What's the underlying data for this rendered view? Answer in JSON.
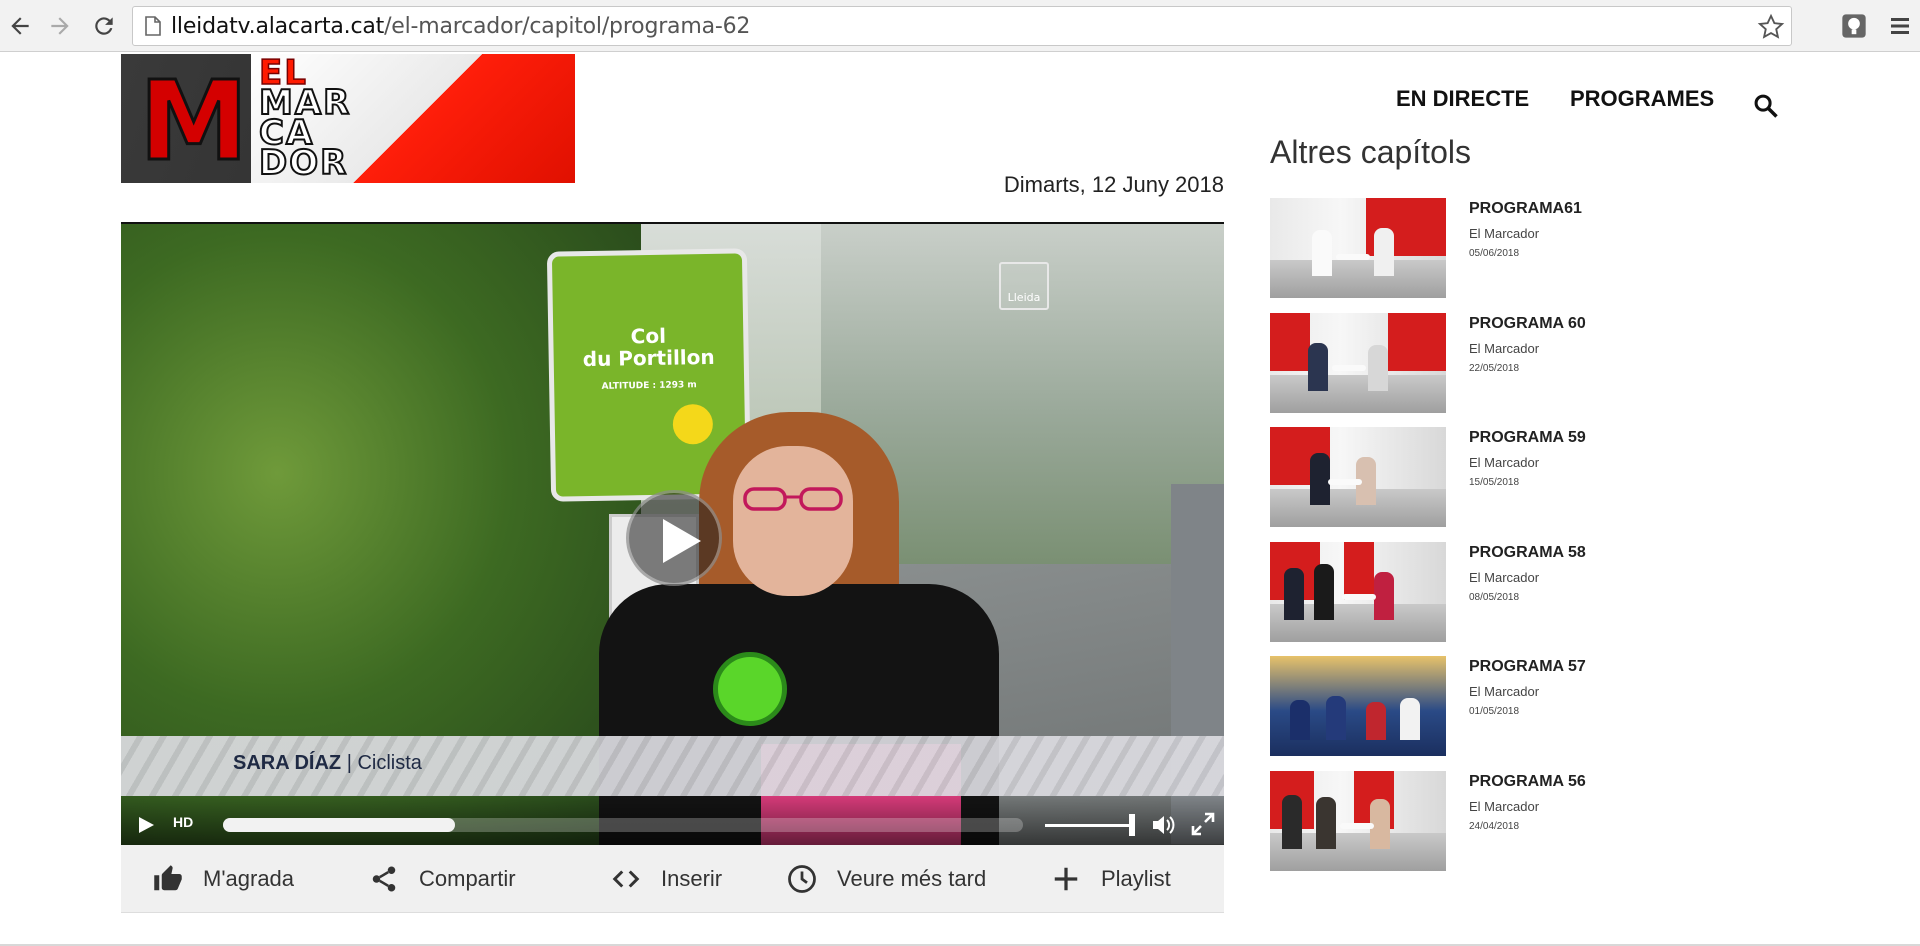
{
  "browser": {
    "url_host": "lleidatv.alacarta.cat",
    "url_path": "/el-marcador/capitol/programa-62"
  },
  "logo": {
    "letter": "M",
    "words": [
      "EL",
      "MAR",
      "CA",
      "DOR"
    ]
  },
  "nav": {
    "items": [
      "EN DIRECTE",
      "PROGRAMES"
    ]
  },
  "date": "Dimarts, 12 Juny 2018",
  "video": {
    "sign_line1": "Col",
    "sign_line2": "du Portillon",
    "sign_altitude": "ALTITUDE : 1293 m",
    "watermark": "Lleida",
    "lower_third_name": "SARA DÍAZ",
    "lower_third_role": "| Ciclista",
    "hd_label": "HD",
    "progress": 0.29
  },
  "actions": [
    {
      "label": "M'agrada",
      "icon": "thumbs-up-icon"
    },
    {
      "label": "Compartir",
      "icon": "share-icon"
    },
    {
      "label": "Inserir",
      "icon": "embed-code-icon"
    },
    {
      "label": "Veure més tard",
      "icon": "clock-icon"
    },
    {
      "label": "Playlist",
      "icon": "plus-icon"
    }
  ],
  "sidebar": {
    "title": "Altres capítols",
    "episodes": [
      {
        "title": "PROGRAMA61",
        "show": "El Marcador",
        "date": "05/06/2018"
      },
      {
        "title": "PROGRAMA 60",
        "show": "El Marcador",
        "date": "22/05/2018"
      },
      {
        "title": "PROGRAMA 59",
        "show": "El Marcador",
        "date": "15/05/2018"
      },
      {
        "title": "PROGRAMA 58",
        "show": "El Marcador",
        "date": "08/05/2018"
      },
      {
        "title": "PROGRAMA 57",
        "show": "El Marcador",
        "date": "01/05/2018"
      },
      {
        "title": "PROGRAMA 56",
        "show": "El Marcador",
        "date": "24/04/2018"
      }
    ]
  },
  "colors": {
    "brand_red": "#e01000",
    "sign_green": "#7ab52a"
  }
}
